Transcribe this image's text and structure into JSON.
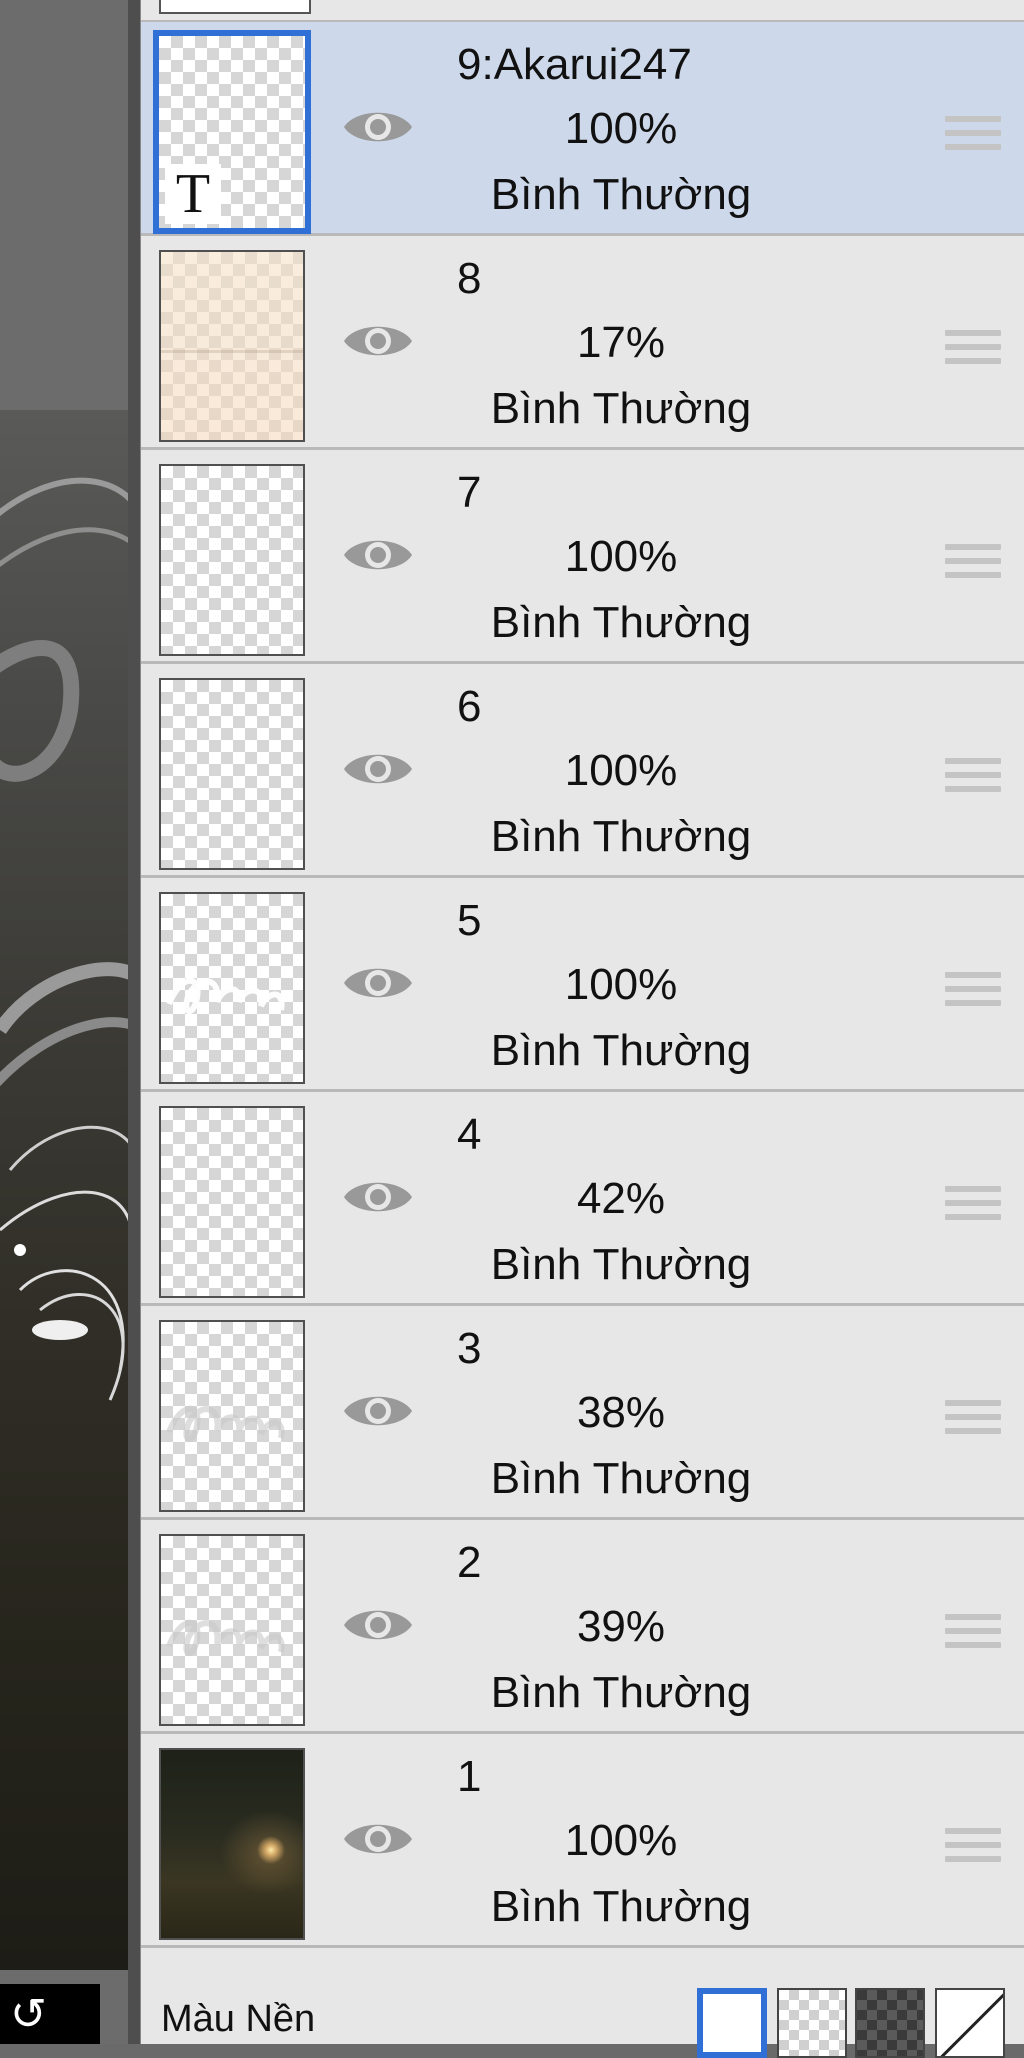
{
  "top_partial": {
    "text": ""
  },
  "layers": [
    {
      "name": "9:Akarui247",
      "opacity": "100%",
      "blend": "Bình Thường",
      "selected": true,
      "thumb": "text"
    },
    {
      "name": "8",
      "opacity": "17%",
      "blend": "Bình Thường",
      "selected": false,
      "thumb": "peach"
    },
    {
      "name": "7",
      "opacity": "100%",
      "blend": "Bình Thường",
      "selected": false,
      "thumb": "transparent"
    },
    {
      "name": "6",
      "opacity": "100%",
      "blend": "Bình Thường",
      "selected": false,
      "thumb": "transparent"
    },
    {
      "name": "5",
      "opacity": "100%",
      "blend": "Bình Thường",
      "selected": false,
      "thumb": "script-white"
    },
    {
      "name": "4",
      "opacity": "42%",
      "blend": "Bình Thường",
      "selected": false,
      "thumb": "transparent"
    },
    {
      "name": "3",
      "opacity": "38%",
      "blend": "Bình Thường",
      "selected": false,
      "thumb": "script-faint"
    },
    {
      "name": "2",
      "opacity": "39%",
      "blend": "Bình Thường",
      "selected": false,
      "thumb": "script-faint"
    },
    {
      "name": "1",
      "opacity": "100%",
      "blend": "Bình Thường",
      "selected": false,
      "thumb": "photo"
    }
  ],
  "thumb_text_glyph": "T",
  "background": {
    "label": "Màu Nền",
    "options": [
      "white",
      "transparent",
      "dark-checker",
      "none"
    ],
    "selected": "white"
  },
  "colors": {
    "panel_bg": "#e7e7e7",
    "selected_row_bg": "#cdd8ea",
    "accent": "#2f6fd6",
    "eye_icon": "#999999"
  },
  "icons": {
    "visibility": "eye-icon",
    "reorder": "drag-handle-icon",
    "canvas_undo": "undo-icon"
  }
}
